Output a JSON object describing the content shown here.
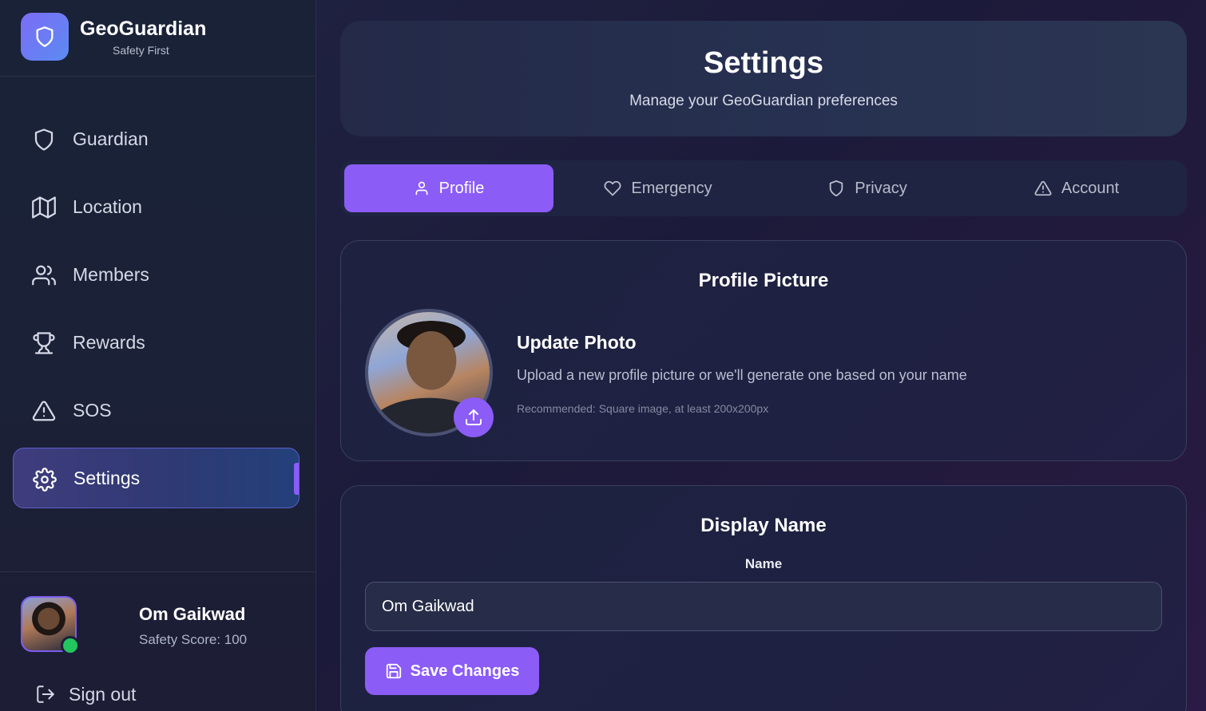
{
  "brand": {
    "name": "GeoGuardian",
    "tagline": "Safety First"
  },
  "sidebar": {
    "items": [
      {
        "label": "Guardian",
        "icon": "shield-icon",
        "active": false
      },
      {
        "label": "Location",
        "icon": "map-icon",
        "active": false
      },
      {
        "label": "Members",
        "icon": "users-icon",
        "active": false
      },
      {
        "label": "Rewards",
        "icon": "trophy-icon",
        "active": false
      },
      {
        "label": "SOS",
        "icon": "alert-triangle-icon",
        "active": false
      },
      {
        "label": "Settings",
        "icon": "gear-icon",
        "active": true
      }
    ]
  },
  "user": {
    "name": "Om Gaikwad",
    "score": "Safety Score: 100",
    "status": "online",
    "signout_label": "Sign out"
  },
  "header": {
    "title": "Settings",
    "subtitle": "Manage your GeoGuardian preferences"
  },
  "tabs": [
    {
      "label": "Profile",
      "icon": "user-icon",
      "active": true
    },
    {
      "label": "Emergency",
      "icon": "heart-icon",
      "active": false
    },
    {
      "label": "Privacy",
      "icon": "shield-icon",
      "active": false
    },
    {
      "label": "Account",
      "icon": "alert-triangle-icon",
      "active": false
    }
  ],
  "profile_picture": {
    "title": "Profile Picture",
    "update_title": "Update Photo",
    "description": "Upload a new profile picture or we'll generate one based on your name",
    "hint": "Recommended: Square image, at least 200x200px"
  },
  "display_name": {
    "title": "Display Name",
    "field_label": "Name",
    "value": "Om Gaikwad",
    "save_label": "Save Changes"
  },
  "colors": {
    "accent": "#8b5cf6",
    "online": "#22c55e",
    "background": "#1c1a3a"
  }
}
